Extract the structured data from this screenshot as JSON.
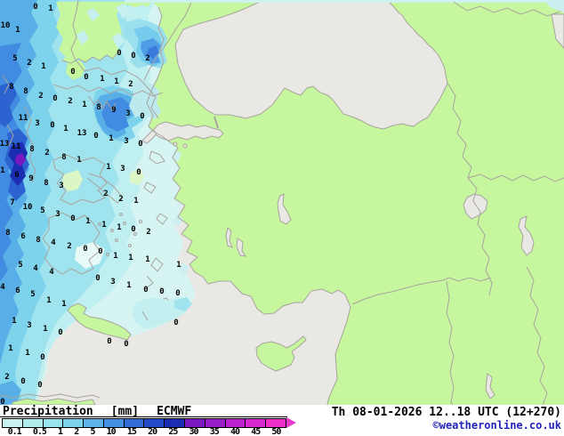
{
  "legend": {
    "title": "Precipitation",
    "units": "[mm]",
    "model": "ECMWF",
    "arrow_color": "#e83ac8",
    "stops": [
      {
        "label": "0.1",
        "color": "#c9f1ef"
      },
      {
        "label": "0.5",
        "color": "#b1ecec"
      },
      {
        "label": "1",
        "color": "#99e3ec"
      },
      {
        "label": "2",
        "color": "#7dd2ec"
      },
      {
        "label": "5",
        "color": "#5db2e8"
      },
      {
        "label": "10",
        "color": "#4590e4"
      },
      {
        "label": "15",
        "color": "#306cd4"
      },
      {
        "label": "20",
        "color": "#2349c6"
      },
      {
        "label": "25",
        "color": "#1b2db2"
      },
      {
        "label": "30",
        "color": "#7a19c0"
      },
      {
        "label": "35",
        "color": "#9a1ec8"
      },
      {
        "label": "40",
        "color": "#bc23ce"
      },
      {
        "label": "45",
        "color": "#d928d2"
      },
      {
        "label": "50",
        "color": "#ee2ec6"
      }
    ]
  },
  "footer": {
    "datetime": "Th 08-01-2026 12..18 UTC (12+270)",
    "copyright": "©weatheronline.co.uk"
  },
  "map": {
    "colors": {
      "sea": "#e9e8e5",
      "land": "#c6f79e",
      "coastline": "#a8a49e",
      "value_text": "#000000"
    },
    "values": [
      [
        40,
        3,
        "0"
      ],
      [
        57,
        5,
        "1"
      ],
      [
        6,
        24,
        "10"
      ],
      [
        20,
        29,
        "1"
      ],
      [
        17,
        61,
        "5"
      ],
      [
        33,
        66,
        "2"
      ],
      [
        49,
        70,
        "1"
      ],
      [
        134,
        55,
        "0"
      ],
      [
        150,
        58,
        "0"
      ],
      [
        166,
        61,
        "2"
      ],
      [
        82,
        76,
        "0"
      ],
      [
        97,
        82,
        "0"
      ],
      [
        115,
        84,
        "1"
      ],
      [
        131,
        87,
        "1"
      ],
      [
        147,
        90,
        "2"
      ],
      [
        13,
        93,
        "8"
      ],
      [
        29,
        98,
        "8"
      ],
      [
        46,
        103,
        "2"
      ],
      [
        62,
        106,
        "0"
      ],
      [
        79,
        109,
        "2"
      ],
      [
        95,
        113,
        "1"
      ],
      [
        111,
        116,
        "8"
      ],
      [
        128,
        119,
        "9"
      ],
      [
        144,
        123,
        "3"
      ],
      [
        160,
        126,
        "0"
      ],
      [
        26,
        128,
        "11"
      ],
      [
        42,
        134,
        "3"
      ],
      [
        59,
        136,
        "0"
      ],
      [
        74,
        140,
        "1"
      ],
      [
        92,
        145,
        "13"
      ],
      [
        108,
        148,
        "0"
      ],
      [
        125,
        151,
        "1"
      ],
      [
        142,
        154,
        "3"
      ],
      [
        158,
        157,
        "0"
      ],
      [
        5,
        157,
        "13"
      ],
      [
        18,
        160,
        "11"
      ],
      [
        36,
        163,
        "8"
      ],
      [
        53,
        167,
        "2"
      ],
      [
        72,
        172,
        "8"
      ],
      [
        89,
        175,
        "1"
      ],
      [
        2,
        187,
        "1"
      ],
      [
        19,
        192,
        "6"
      ],
      [
        35,
        196,
        "9"
      ],
      [
        52,
        201,
        "8"
      ],
      [
        69,
        204,
        "3"
      ],
      [
        122,
        183,
        "1"
      ],
      [
        138,
        185,
        "3"
      ],
      [
        156,
        189,
        "0"
      ],
      [
        119,
        213,
        "2"
      ],
      [
        136,
        219,
        "2"
      ],
      [
        153,
        221,
        "1"
      ],
      [
        14,
        223,
        "7"
      ],
      [
        31,
        228,
        "10"
      ],
      [
        48,
        232,
        "5"
      ],
      [
        65,
        236,
        "3"
      ],
      [
        82,
        241,
        "0"
      ],
      [
        99,
        244,
        "1"
      ],
      [
        117,
        248,
        "1"
      ],
      [
        134,
        251,
        "1"
      ],
      [
        150,
        253,
        "0"
      ],
      [
        167,
        256,
        "2"
      ],
      [
        9,
        257,
        "8"
      ],
      [
        26,
        261,
        "6"
      ],
      [
        43,
        265,
        "8"
      ],
      [
        60,
        268,
        "4"
      ],
      [
        78,
        272,
        "2"
      ],
      [
        96,
        275,
        "0"
      ],
      [
        113,
        278,
        "0"
      ],
      [
        130,
        283,
        "1"
      ],
      [
        147,
        285,
        "1"
      ],
      [
        166,
        287,
        "1"
      ],
      [
        23,
        293,
        "5"
      ],
      [
        40,
        297,
        "4"
      ],
      [
        58,
        301,
        "4"
      ],
      [
        201,
        293,
        "1"
      ],
      [
        110,
        308,
        "0"
      ],
      [
        127,
        312,
        "3"
      ],
      [
        145,
        316,
        "1"
      ],
      [
        164,
        321,
        "0"
      ],
      [
        182,
        323,
        "0"
      ],
      [
        200,
        325,
        "0"
      ],
      [
        3,
        318,
        "4"
      ],
      [
        20,
        322,
        "6"
      ],
      [
        37,
        326,
        "5"
      ],
      [
        55,
        333,
        "1"
      ],
      [
        72,
        337,
        "1"
      ],
      [
        16,
        356,
        "1"
      ],
      [
        33,
        361,
        "3"
      ],
      [
        51,
        365,
        "1"
      ],
      [
        68,
        369,
        "0"
      ],
      [
        198,
        358,
        "0"
      ],
      [
        12,
        387,
        "1"
      ],
      [
        31,
        392,
        "1"
      ],
      [
        48,
        397,
        "0"
      ],
      [
        123,
        379,
        "0"
      ],
      [
        142,
        382,
        "0"
      ],
      [
        8,
        419,
        "2"
      ],
      [
        26,
        424,
        "0"
      ],
      [
        45,
        428,
        "0"
      ],
      [
        2,
        447,
        "0"
      ]
    ]
  }
}
